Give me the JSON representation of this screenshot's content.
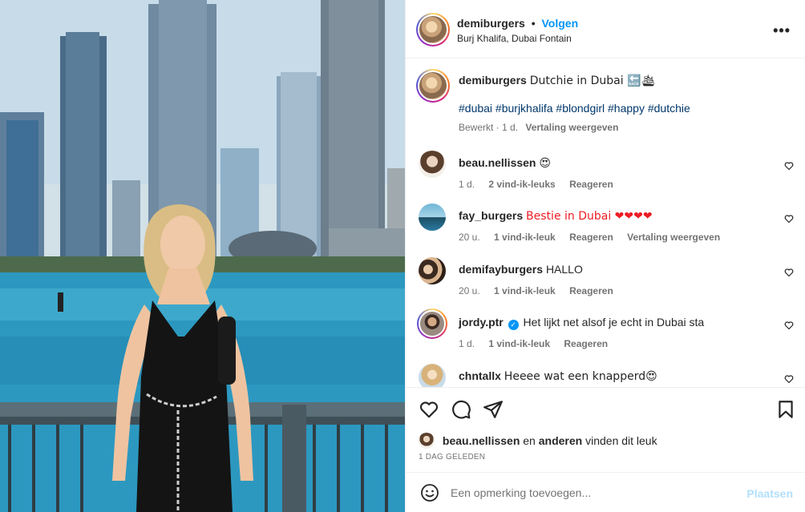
{
  "post": {
    "username": "demiburgers",
    "follow_label": "Volgen",
    "location": "Burj Khalifa, Dubai Fontain",
    "more_icon": "more-horizontal-icon",
    "caption": {
      "username": "demiburgers",
      "text": "Dutchie in Dubai 🔙🛳",
      "hashtags": "#dubai #burjkhalifa #blondgirl #happy #dutchie",
      "edited": "Bewerkt · 1 d.",
      "translate": "Vertaling weergeven"
    }
  },
  "comments": [
    {
      "username": "beau.nellissen",
      "text": "😍",
      "time": "1 d.",
      "likes": "2 vind-ik-leuks",
      "reply": "Reageren",
      "translate": ""
    },
    {
      "username": "fay_burgers",
      "text": "Bestie in Dubai ❤❤❤❤",
      "time": "20 u.",
      "likes": "1 vind-ik-leuk",
      "reply": "Reageren",
      "translate": "Vertaling weergeven"
    },
    {
      "username": "demifayburgers",
      "text": "HALLO",
      "time": "20 u.",
      "likes": "1 vind-ik-leuk",
      "reply": "Reageren",
      "translate": ""
    },
    {
      "username": "jordy.ptr",
      "text": "Het lijkt net alsof je echt in Dubai sta",
      "time": "1 d.",
      "likes": "1 vind-ik-leuk",
      "reply": "Reageren",
      "translate": ""
    },
    {
      "username": "chntallx",
      "text": "Heeee wat een knapperd😍",
      "time": "",
      "likes": "",
      "reply": "",
      "translate": ""
    }
  ],
  "likes_line": {
    "user": "beau.nellissen",
    "connector": "en",
    "others": "anderen",
    "suffix": "vinden dit leuk"
  },
  "date_label": "1 DAG GELEDEN",
  "add_comment": {
    "placeholder": "Een opmerking toevoegen...",
    "post_label": "Plaatsen"
  },
  "colors": {
    "accent": "#0095f6",
    "post_disabled": "#b2dffc",
    "hashtag": "#00376b"
  }
}
